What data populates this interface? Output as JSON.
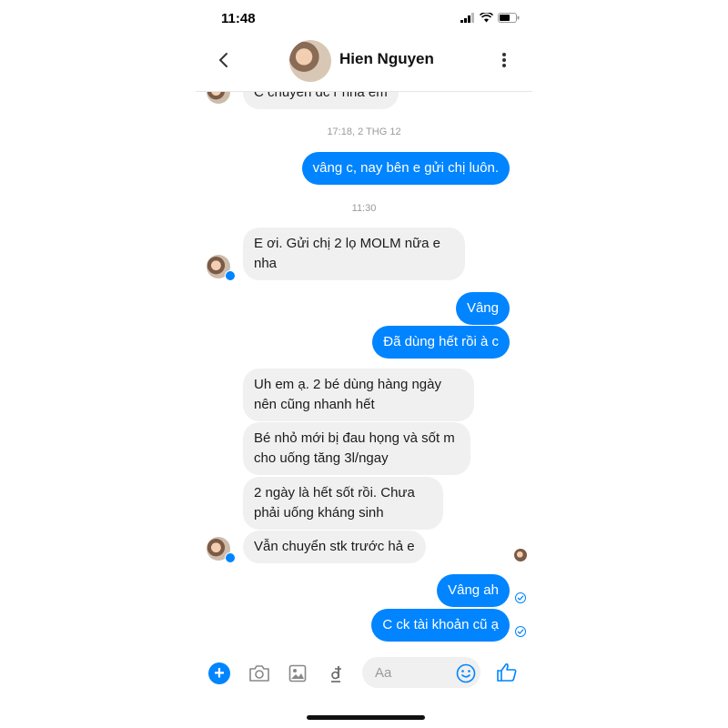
{
  "status_bar": {
    "time": "11:48"
  },
  "header": {
    "contact_name": "Hien Nguyen"
  },
  "conversation": {
    "top_partial_message": "C chuyển dc r nha em",
    "timestamp_1": "17:18, 2 THG 12",
    "out_msg_1": "vâng c, nay bên e gửi chị luôn.",
    "timestamp_2": "11:30",
    "in_msg_1": "E ơi. Gửi chị 2 lọ MOLM nữa e nha",
    "out_msg_2": "Vâng",
    "out_msg_3": "Đã dùng hết rồi à c",
    "in_msg_2": "Uh em ạ. 2 bé dùng hàng ngày nên cũng nhanh hết",
    "in_msg_3": "Bé nhỏ mới bị đau họng và sốt m cho uống tăng 3l/ngay",
    "in_msg_4": "2 ngày là hết sốt rồi. Chưa phải uống kháng sinh",
    "in_msg_5": "Vẫn chuyển stk trước hả e",
    "out_msg_4": "Vâng ah",
    "out_msg_5": "C ck tài khoản cũ ạ"
  },
  "composer": {
    "placeholder": "Aa"
  },
  "colors": {
    "accent": "#0084ff",
    "incoming_bubble": "#f0f0f0"
  },
  "icons": [
    "back-icon",
    "more-icon",
    "plus-icon",
    "camera-icon",
    "image-icon",
    "dong-icon",
    "emoji-icon",
    "like-icon",
    "check-icon"
  ]
}
